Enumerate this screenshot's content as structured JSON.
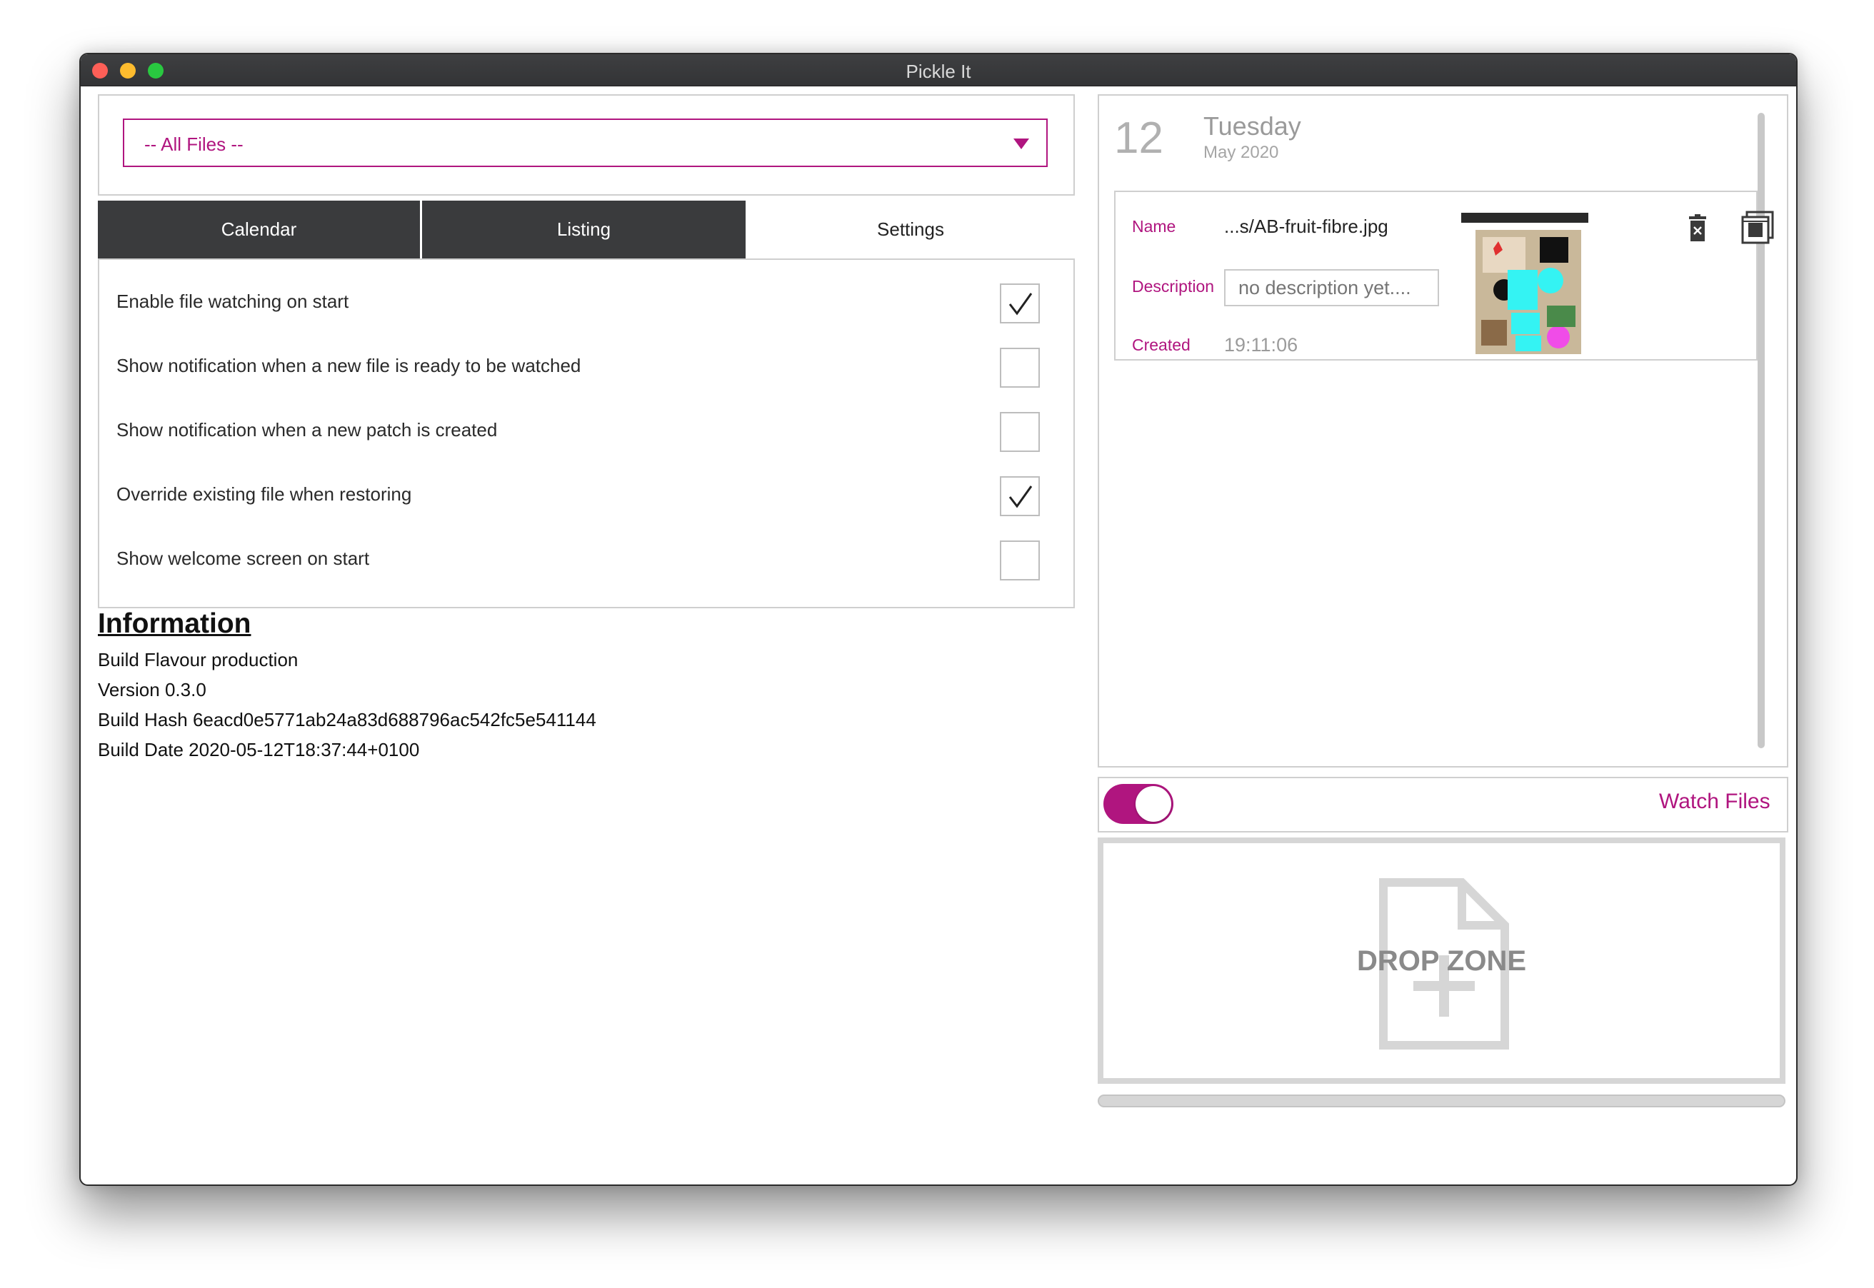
{
  "window": {
    "title": "Pickle It"
  },
  "filter": {
    "selected": "-- All Files --"
  },
  "tabs": [
    {
      "label": "Calendar",
      "active": false
    },
    {
      "label": "Listing",
      "active": false
    },
    {
      "label": "Settings",
      "active": true
    }
  ],
  "settings": [
    {
      "label": "Enable file watching on start",
      "checked": true
    },
    {
      "label": "Show notification when a new file is ready to be watched",
      "checked": false
    },
    {
      "label": "Show notification when a new patch is created",
      "checked": false
    },
    {
      "label": "Override existing file when restoring",
      "checked": true
    },
    {
      "label": "Show welcome screen on start",
      "checked": false
    }
  ],
  "information": {
    "title": "Information",
    "lines": [
      "Build Flavour production",
      "Version 0.3.0",
      "Build Hash 6eacd0e5771ab24a83d688796ac542fc5e541144",
      "Build Date 2020-05-12T18:37:44+0100"
    ]
  },
  "date": {
    "day": "12",
    "weekday": "Tuesday",
    "month_year": "May 2020"
  },
  "entry": {
    "name_label": "Name",
    "name_value": "...s/AB-fruit-fibre.jpg",
    "description_label": "Description",
    "description_placeholder": "no description yet....",
    "created_label": "Created",
    "created_value": "19:11:06",
    "icons": [
      "delete-icon",
      "restore-icon"
    ]
  },
  "watch": {
    "label": "Watch Files",
    "enabled": true
  },
  "drop_zone": {
    "label": "DROP ZONE",
    "icon": "file-add-icon"
  },
  "colors": {
    "accent": "#b0157f",
    "tab_dark": "#3a3b3d",
    "border": "#cfcfcf"
  }
}
